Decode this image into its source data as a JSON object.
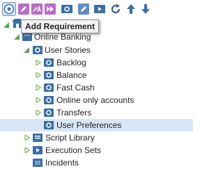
{
  "toolbar": {
    "buttons": [
      {
        "name": "add-requirement-button",
        "icon": "add-requirement-icon",
        "color": "#3b78c2"
      },
      {
        "name": "edit-button",
        "icon": "pencil-icon",
        "color": "#b86cc9"
      },
      {
        "name": "edit-text-button",
        "icon": "pencil-text-icon",
        "color": "#b86cc9"
      },
      {
        "name": "forward-button",
        "icon": "fast-forward-icon",
        "color": "#b86cc9"
      },
      {
        "name": "folder-button",
        "icon": "folder-icon",
        "color": "#3a6ea5"
      },
      {
        "name": "edit-folder-button",
        "icon": "folder-edit-icon",
        "color": "#3a6ea5"
      },
      {
        "name": "play-folder-button",
        "icon": "folder-play-icon",
        "color": "#3a6ea5"
      },
      {
        "name": "refresh-button",
        "icon": "refresh-icon",
        "color": "#3a6ea5"
      },
      {
        "name": "move-up-button",
        "icon": "arrow-up-icon",
        "color": "#3a6ea5"
      },
      {
        "name": "move-down-button",
        "icon": "arrow-down-icon",
        "color": "#3a6ea5"
      }
    ],
    "tooltip": "Add Requirement"
  },
  "colors": {
    "folder": "#3a6ea5",
    "expander_open": "#5aa64a",
    "expander_closed": "#7bbd5b",
    "selected_row": "#d9e5f4"
  },
  "tree": {
    "root_icon": "home-icon",
    "nodes": [
      {
        "label": "Online Banking",
        "state": "open",
        "icon": "project-icon",
        "level": 1
      },
      {
        "label": "User Stories",
        "state": "open",
        "icon": "folder-icon",
        "level": 2
      },
      {
        "label": "Backlog",
        "state": "closed",
        "icon": "folder-icon",
        "level": 3
      },
      {
        "label": "Balance",
        "state": "closed",
        "icon": "folder-icon",
        "level": 3
      },
      {
        "label": "Fast Cash",
        "state": "closed",
        "icon": "folder-icon",
        "level": 3
      },
      {
        "label": "Online only accounts",
        "state": "closed",
        "icon": "folder-icon",
        "level": 3
      },
      {
        "label": "Transfers",
        "state": "closed",
        "icon": "folder-icon",
        "level": 3
      },
      {
        "label": "User Preferences",
        "state": "leaf",
        "icon": "folder-icon",
        "level": 3,
        "selected": true
      },
      {
        "label": "Script Library",
        "state": "closed",
        "icon": "folder-icon",
        "level": 2
      },
      {
        "label": "Execution Sets",
        "state": "closed",
        "icon": "folder-icon",
        "level": 2
      },
      {
        "label": "Incidents",
        "state": "leaf",
        "icon": "folder-icon",
        "level": 2
      }
    ]
  }
}
